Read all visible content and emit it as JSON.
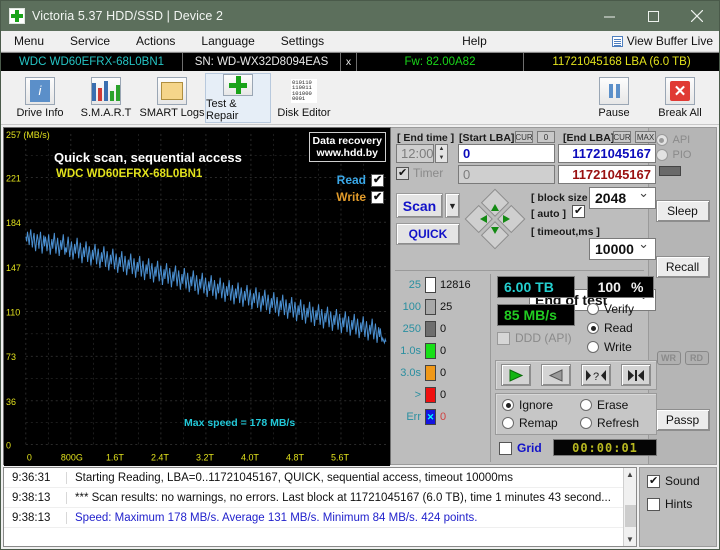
{
  "window": {
    "title": "Victoria 5.37 HDD/SSD | Device 2",
    "icon": "green-cross-icon",
    "minimize": "−",
    "maximize": "□",
    "close": "✕"
  },
  "menu": {
    "items": [
      "Menu",
      "Service",
      "Actions",
      "Language",
      "Settings"
    ],
    "help": "Help",
    "view_buffer": "View Buffer Live"
  },
  "drivebar": {
    "model": "WDC WD60EFRX-68L0BN1",
    "serial": "SN: WD-WX32D8094EAS",
    "close_x": "x",
    "firmware": "Fw: 82.00A82",
    "capacity": "11721045168 LBA (6.0 TB)"
  },
  "toolbar": {
    "buttons": [
      {
        "label": "Drive Info",
        "icon": "info-icon"
      },
      {
        "label": "S.M.A.R.T",
        "icon": "bars-icon"
      },
      {
        "label": "SMART Logs",
        "icon": "folder-pencil-icon"
      },
      {
        "label": "Test & Repair",
        "icon": "green-plus-icon"
      },
      {
        "label": "Disk Editor",
        "icon": "binary-page-icon"
      }
    ],
    "pause": "Pause",
    "break_all": "Break All"
  },
  "graph": {
    "title": "Quick scan, sequential access",
    "subtitle": "WDC WD60EFRX-68L0BN1",
    "badge_line1": "Data recovery",
    "badge_line2": "www.hdd.by",
    "read_label": "Read",
    "write_label": "Write",
    "read_checked": true,
    "write_checked": true,
    "max_speed_label": "Max speed = 178 MB/s",
    "unit": "257 (MB/s)"
  },
  "chart_data": {
    "type": "line",
    "title": "Quick scan, sequential access",
    "subtitle": "WDC WD60EFRX-68L0BN1",
    "xlabel": "",
    "ylabel": "MB/s",
    "ylim": [
      0,
      257
    ],
    "xlim": [
      0,
      6000
    ],
    "yticks": [
      257,
      221,
      184,
      147,
      110,
      73,
      36,
      0
    ],
    "ytick_labels": [
      "257 (MB/s)",
      "221",
      "184",
      "147",
      "110",
      "73",
      "36",
      "0"
    ],
    "xticks": [
      0,
      800,
      1600,
      2400,
      3200,
      4000,
      4800,
      5600
    ],
    "xtick_labels": [
      "0",
      "800G",
      "1.6T",
      "2.4T",
      "3.2T",
      "4.0T",
      "4.8T",
      "5.6T"
    ],
    "grid": true,
    "line_color": "#4a8fd0",
    "max_value": 178,
    "min_value": 84,
    "average_value": 131,
    "points_count": 424,
    "annotations": [
      "Max speed = 178 MB/s"
    ],
    "values": [
      172,
      168,
      176,
      171,
      165,
      173,
      178,
      170,
      163,
      171,
      175,
      166,
      160,
      168,
      174,
      169,
      162,
      170,
      176,
      167,
      158,
      166,
      173,
      164,
      172,
      168,
      160,
      167,
      174,
      165,
      157,
      164,
      170,
      162,
      169,
      175,
      166,
      158,
      165,
      171,
      163,
      156,
      163,
      169,
      161,
      168,
      174,
      165,
      157,
      163,
      159,
      166,
      172,
      163,
      155,
      162,
      168,
      160,
      153,
      160,
      166,
      158,
      165,
      171,
      162,
      154,
      161,
      167,
      158,
      150,
      157,
      163,
      155,
      162,
      168,
      159,
      151,
      158,
      164,
      156,
      148,
      155,
      161,
      153,
      160,
      166,
      157,
      149,
      156,
      162,
      154,
      146,
      153,
      159,
      151,
      158,
      164,
      155,
      147,
      154,
      160,
      152,
      144,
      151,
      157,
      149,
      156,
      162,
      153,
      145,
      152,
      158,
      150,
      142,
      149,
      155,
      147,
      154,
      160,
      151,
      143,
      150,
      156,
      148,
      140,
      147,
      153,
      145,
      152,
      158,
      149,
      141,
      148,
      154,
      146,
      138,
      145,
      151,
      143,
      150,
      156,
      147,
      139,
      146,
      152,
      144,
      136,
      143,
      149,
      141,
      148,
      154,
      145,
      137,
      144,
      150,
      142,
      134,
      141,
      147,
      139,
      146,
      152,
      143,
      135,
      142,
      148,
      140,
      132,
      139,
      145,
      137,
      144,
      150,
      141,
      133,
      140,
      146,
      138,
      130,
      137,
      143,
      135,
      142,
      148,
      139,
      131,
      138,
      144,
      136,
      128,
      135,
      141,
      133,
      140,
      146,
      137,
      129,
      136,
      142,
      134,
      126,
      133,
      139,
      131,
      138,
      144,
      135,
      127,
      134,
      140,
      132,
      124,
      131,
      137,
      129,
      136,
      142,
      133,
      125,
      132,
      138,
      130,
      122,
      129,
      135,
      127,
      134,
      140,
      131,
      123,
      130,
      136,
      128,
      120,
      127,
      133,
      125,
      132,
      138,
      129,
      121,
      128,
      134,
      126,
      118,
      125,
      131,
      123,
      130,
      136,
      127,
      119,
      126,
      132,
      124,
      116,
      123,
      129,
      121,
      128,
      134,
      125,
      117,
      124,
      130,
      122,
      114,
      121,
      127,
      119,
      126,
      132,
      123,
      115,
      122,
      128,
      120,
      112,
      119,
      125,
      117,
      124,
      130,
      121,
      113,
      120,
      126,
      118,
      110,
      117,
      123,
      115,
      122,
      128,
      119,
      111,
      118,
      124,
      116,
      108,
      115,
      121,
      113,
      120,
      126,
      117,
      109,
      116,
      122,
      114,
      106,
      113,
      119,
      111,
      118,
      124,
      115,
      107,
      114,
      120,
      112,
      104,
      111,
      117,
      109,
      116,
      122,
      113,
      105,
      112,
      118,
      110,
      102,
      109,
      115,
      107,
      114,
      120,
      111,
      103,
      110,
      116,
      108,
      100,
      107,
      113,
      105,
      112,
      118,
      109,
      101,
      108,
      114,
      106,
      98,
      105,
      111,
      103,
      110,
      116,
      107,
      99,
      106,
      112,
      104,
      96,
      103,
      109,
      101,
      108,
      114,
      105,
      97,
      104,
      110,
      102,
      94,
      101,
      107,
      99,
      106,
      112,
      103,
      95,
      102,
      108,
      100,
      92,
      99,
      105,
      97,
      104,
      110,
      101,
      93,
      100,
      106,
      98,
      90,
      97,
      103,
      95,
      102,
      108,
      99,
      91,
      98,
      104,
      96,
      88,
      95,
      101,
      93,
      100,
      106,
      97,
      89,
      96,
      102,
      94,
      86,
      93,
      99,
      91,
      98,
      104,
      95,
      87,
      94,
      100,
      92,
      84,
      91,
      97,
      89,
      96,
      90,
      85,
      88,
      86,
      84,
      87,
      85
    ]
  },
  "controls": {
    "end_time_label": "[ End time ]",
    "end_time_value": "12:00",
    "timer_label": "Timer",
    "timer_checked": true,
    "timer_enabled": false,
    "start_lba_label": "[Start LBA]",
    "start_lba_cur": "CUR",
    "start_lba_zero": "0",
    "start_lba_value": "0",
    "start_lba_second": "0",
    "end_lba_label": "[End LBA]",
    "end_lba_cur": "CUR",
    "end_lba_max": "MAX",
    "end_lba_value": "11721045167",
    "end_lba_second": "11721045167",
    "scan_button": "Scan",
    "quick_button": "QUICK",
    "block_size_label": "[ block size ]",
    "auto_label": "[ auto ]",
    "auto_checked": true,
    "block_size_value": "2048",
    "timeout_label": "[ timeout,ms ]",
    "timeout_value": "10000",
    "end_of_test": "End of test"
  },
  "legend": {
    "rows": [
      {
        "threshold": "25",
        "color": "#ffffff",
        "count": "12816"
      },
      {
        "threshold": "100",
        "color": "#a8a8a8",
        "count": "25"
      },
      {
        "threshold": "250",
        "color": "#6e6e6e",
        "count": "0"
      },
      {
        "threshold": "1.0s",
        "color": "#18e018",
        "count": "0"
      },
      {
        "threshold": "3.0s",
        "color": "#f09818",
        "count": "0"
      },
      {
        "threshold": ">",
        "color": "#f01010",
        "count": "0"
      },
      {
        "threshold": "Err",
        "color": "#1414e0",
        "count": "0"
      }
    ]
  },
  "status": {
    "capacity": "6.00 TB",
    "speed": "85 MB/s",
    "percent": "100",
    "percent_sign": "%",
    "ddd_label": "DDD (API)",
    "ddd_checked": false,
    "modes": [
      "Verify",
      "Read",
      "Write"
    ],
    "mode_selected": "Read",
    "actions": [
      "Ignore",
      "Erase",
      "Remap",
      "Refresh"
    ],
    "action_selected": "Ignore",
    "grid_label": "Grid",
    "grid_checked": false,
    "timer_display": "00:00:01",
    "transport": [
      "play-icon",
      "reverse-icon",
      "seek-query-icon",
      "seek-end-icon"
    ]
  },
  "sidecol": {
    "api_label": "API",
    "pio_label": "PIO",
    "api_selected": true,
    "sleep": "Sleep",
    "recall": "Recall",
    "wr": "WR",
    "rd": "RD",
    "passp": "Passp"
  },
  "log": {
    "lines": [
      {
        "time": "9:36:31",
        "message": "Starting Reading, LBA=0..11721045167, QUICK, sequential access, timeout 10000ms",
        "color": "#111111"
      },
      {
        "time": "9:38:13",
        "message": "*** Scan results: no warnings, no errors. Last block at 11721045167 (6.0 TB), time 1 minutes 43 second...",
        "color": "#111111"
      },
      {
        "time": "9:38:13",
        "message": "Speed: Maximum 178 MB/s. Average 131 MB/s. Minimum 84 MB/s. 424 points.",
        "color": "#2222cc"
      }
    ],
    "sound_label": "Sound",
    "sound_checked": true,
    "hints_label": "Hints",
    "hints_checked": false
  }
}
